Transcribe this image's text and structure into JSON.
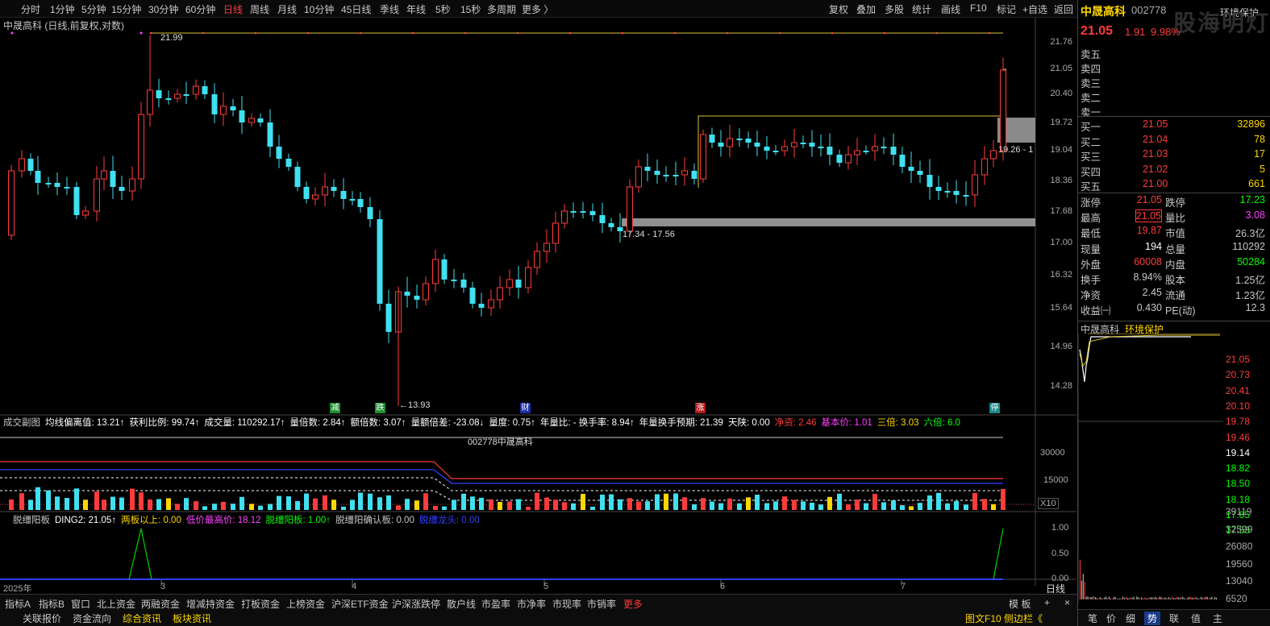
{
  "periods": [
    "分时",
    "1分钟",
    "5分钟",
    "15分钟",
    "30分钟",
    "60分钟",
    "日线",
    "周线",
    "月线",
    "10分钟",
    "45日线",
    "季线",
    "年线",
    "5秒",
    "15秒",
    "多周期",
    "更多 〉"
  ],
  "active_period": "日线",
  "toolbar_right": [
    "复权",
    "叠加",
    "多股",
    "统计",
    "画线",
    "F10",
    "标记",
    "+自选",
    "返回"
  ],
  "chart": {
    "title": "中晟高科 (日线,前复权,对数)",
    "price_axis": [
      "21.76",
      "21.05",
      "20.40",
      "19.72",
      "19.04",
      "18.36",
      "17.68",
      "17.00",
      "16.32",
      "15.64",
      "14.96",
      "14.28"
    ],
    "high_label": "21.99",
    "low_label": "←13.93",
    "range_label": "17.34 - 17.56",
    "right_label": "19.26 - 1",
    "markers": [
      {
        "t": "减",
        "c": "#1e8e2e"
      },
      {
        "t": "跌",
        "c": "#1e8e2e"
      },
      {
        "t": "财",
        "c": "#1a2ea8"
      },
      {
        "t": "涨",
        "c": "#b01818"
      },
      {
        "t": "停",
        "c": "#1a8a8a"
      }
    ],
    "date_labels": [
      "2025年",
      "3",
      "4",
      "5",
      "6",
      "7"
    ],
    "period_label": "日线"
  },
  "indicator": {
    "items": [
      {
        "t": "成交副图",
        "c": "#c8c8c8"
      },
      {
        "t": "均线偏离值: 13.21↑",
        "c": "#ffffff"
      },
      {
        "t": "获利比例: 99.74↑",
        "c": "#ffffff"
      },
      {
        "t": "成交量: 110292.17↑",
        "c": "#ffffff"
      },
      {
        "t": "量倍数: 2.84↑",
        "c": "#ffffff"
      },
      {
        "t": "额倍数: 3.07↑",
        "c": "#ffffff"
      },
      {
        "t": "量额倍差: -23.08↓",
        "c": "#ffffff"
      },
      {
        "t": "量度: 0.75↑",
        "c": "#ffffff"
      },
      {
        "t": "年量比: - 换手率: 8.94↑",
        "c": "#ffffff"
      },
      {
        "t": "年量换手预期: 21.39",
        "c": "#ffffff"
      },
      {
        "t": "天陕: 0.00",
        "c": "#ffffff"
      },
      {
        "t": "净资: 2.46",
        "c": "#ff3b3b"
      },
      {
        "t": "基本价: 1.01",
        "c": "#ff40ff"
      },
      {
        "t": "三倍: 3.03",
        "c": "#ffd700"
      },
      {
        "t": "六倍: 6.0",
        "c": "#00ff00"
      }
    ],
    "subtitle": "002778中晟高科",
    "vol_axis": [
      "30000",
      "15000"
    ],
    "x_label": "X10"
  },
  "tuo": {
    "items": [
      {
        "t": "脱缰阳板",
        "c": "#c8c8c8"
      },
      {
        "t": "DING2: 21.05↑",
        "c": "#ffffff"
      },
      {
        "t": "两板以上: 0.00",
        "c": "#ffd700"
      },
      {
        "t": "低价最高价: 18.12",
        "c": "#ff40ff"
      },
      {
        "t": "脱缰阳板: 1.00↑",
        "c": "#00ff00"
      },
      {
        "t": "脱缰阳确认板: 0.00",
        "c": "#c8c8c8"
      },
      {
        "t": "脱缰龙头: 0.00",
        "c": "#3040ff"
      }
    ],
    "axis": [
      "1.00",
      "0.50",
      "0.00"
    ]
  },
  "bottom_tabs": [
    "指标A",
    "指标B",
    "窗口",
    "北上资金",
    "两融资金",
    "增减持资金",
    "打板资金",
    "上榜资金",
    "沪深ETF资金",
    "沪深涨跌停",
    "散户线",
    "市盈率",
    "市净率",
    "市现率",
    "市销率",
    "更多"
  ],
  "bottom_tabs2": [
    "关联报价",
    "资金流向",
    "综合资讯",
    "板块资讯"
  ],
  "bottom_right": [
    "模 板",
    "+",
    "×"
  ],
  "stock": {
    "name": "中晟高科",
    "code": "002778",
    "tag": "环境保护",
    "price": "21.05",
    "change": "1.91",
    "pct": "9.98%"
  },
  "order_book": {
    "sell": [
      "卖五",
      "卖四",
      "卖三",
      "卖二",
      "卖一"
    ],
    "buy": [
      {
        "label": "买一",
        "price": "21.05",
        "vol": "32896"
      },
      {
        "label": "买二",
        "price": "21.04",
        "vol": "78"
      },
      {
        "label": "买三",
        "price": "21.03",
        "vol": "17"
      },
      {
        "label": "买四",
        "price": "21.02",
        "vol": "5"
      },
      {
        "label": "买五",
        "price": "21.00",
        "vol": "661"
      }
    ]
  },
  "stats": [
    {
      "k1": "涨停",
      "v1": "21.05",
      "c1": "#ff3b3b",
      "k2": "跌停",
      "v2": "17.23",
      "c2": "#00ff00"
    },
    {
      "k1": "最高",
      "v1": "21.05",
      "c1": "#ff3b3b",
      "k2": "量比",
      "v2": "3.08",
      "c2": "#ff40ff"
    },
    {
      "k1": "最低",
      "v1": "19.87",
      "c1": "#ff3b3b",
      "k2": "市值",
      "v2": "26.3亿",
      "c2": "#c8c8c8"
    },
    {
      "k1": "现量",
      "v1": "194",
      "c1": "#ffffff",
      "k2": "总量",
      "v2": "110292",
      "c2": "#c8c8c8"
    },
    {
      "k1": "外盘",
      "v1": "60008",
      "c1": "#ff3b3b",
      "k2": "内盘",
      "v2": "50284",
      "c2": "#00ff00"
    },
    {
      "k1": "换手",
      "v1": "8.94%",
      "c1": "#c8c8c8",
      "k2": "股本",
      "v2": "1.25亿",
      "c2": "#c8c8c8"
    },
    {
      "k1": "净资",
      "v1": "2.45",
      "c1": "#c8c8c8",
      "k2": "流通",
      "v2": "1.23亿",
      "c2": "#c8c8c8"
    },
    {
      "k1": "收益㈠",
      "v1": "0.430",
      "c1": "#c8c8c8",
      "k2": "PE(动)",
      "v2": "12.3",
      "c2": "#c8c8c8"
    }
  ],
  "mini": {
    "price_axis": [
      {
        "v": "21.05",
        "c": "#ff3b3b"
      },
      {
        "v": "20.73",
        "c": "#ff3b3b"
      },
      {
        "v": "20.41",
        "c": "#ff3b3b"
      },
      {
        "v": "20.10",
        "c": "#ff3b3b"
      },
      {
        "v": "19.78",
        "c": "#ff3b3b"
      },
      {
        "v": "19.46",
        "c": "#ff3b3b"
      },
      {
        "v": "19.14",
        "c": "#ffffff"
      },
      {
        "v": "18.82",
        "c": "#00ff00"
      },
      {
        "v": "18.50",
        "c": "#00ff00"
      },
      {
        "v": "18.18",
        "c": "#00ff00"
      },
      {
        "v": "17.85",
        "c": "#00ff00"
      },
      {
        "v": "17.53",
        "c": "#00ff00"
      }
    ],
    "vol_axis": [
      "39119",
      "32599",
      "26080",
      "19560",
      "13040",
      "6520"
    ]
  },
  "right_tabs": [
    "笔",
    "价",
    "细",
    "势",
    "联",
    "值",
    "主"
  ],
  "active_right_tab": "势",
  "right_bottom_extra": "图文F10 侧边栏《",
  "watermark": "股海明灯"
}
